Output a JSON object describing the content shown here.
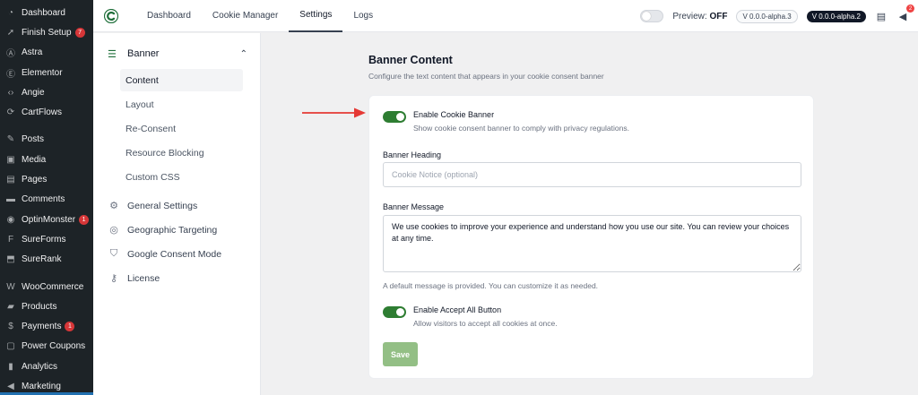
{
  "wp_menu": [
    {
      "label": "Dashboard",
      "icon": "dashboard-icon"
    },
    {
      "label": "Finish Setup",
      "icon": "rocket-icon",
      "badge": "7"
    },
    {
      "label": "Astra",
      "icon": "astra-icon"
    },
    {
      "label": "Elementor",
      "icon": "elementor-icon"
    },
    {
      "label": "Angie",
      "icon": "angie-icon"
    },
    {
      "label": "CartFlows",
      "icon": "cartflows-icon"
    },
    {
      "label": "Posts",
      "icon": "pin-icon"
    },
    {
      "label": "Media",
      "icon": "media-icon"
    },
    {
      "label": "Pages",
      "icon": "pages-icon"
    },
    {
      "label": "Comments",
      "icon": "comment-icon"
    },
    {
      "label": "OptinMonster",
      "icon": "optinmonster-icon",
      "badge": "1"
    },
    {
      "label": "SureForms",
      "icon": "sureforms-icon"
    },
    {
      "label": "SureRank",
      "icon": "surerank-icon"
    },
    {
      "label": "WooCommerce",
      "icon": "woocommerce-icon"
    },
    {
      "label": "Products",
      "icon": "products-icon"
    },
    {
      "label": "Payments",
      "icon": "payments-icon",
      "badge": "1"
    },
    {
      "label": "Power Coupons",
      "icon": "coupon-icon"
    },
    {
      "label": "Analytics",
      "icon": "analytics-icon"
    },
    {
      "label": "Marketing",
      "icon": "megaphone-icon"
    }
  ],
  "topbar": {
    "tabs": [
      "Dashboard",
      "Cookie Manager",
      "Settings",
      "Logs"
    ],
    "active_tab": "Settings",
    "preview_label": "Preview:",
    "preview_state": "OFF",
    "version_light": "V 0.0.0-alpha.3",
    "version_dark": "V 0.0.0-alpha.2",
    "notification_count": "2"
  },
  "settings_nav": {
    "section": "Banner",
    "sub_items": [
      "Content",
      "Layout",
      "Re-Consent",
      "Resource Blocking",
      "Custom CSS"
    ],
    "active_sub": "Content",
    "items": [
      {
        "label": "General Settings",
        "icon": "gear-icon"
      },
      {
        "label": "Geographic Targeting",
        "icon": "globe-icon"
      },
      {
        "label": "Google Consent Mode",
        "icon": "shield-icon"
      },
      {
        "label": "License",
        "icon": "key-icon"
      }
    ]
  },
  "main": {
    "title": "Banner Content",
    "subtitle": "Configure the text content that appears in your cookie consent banner",
    "enable_banner_label": "Enable Cookie Banner",
    "enable_banner_desc": "Show cookie consent banner to comply with privacy regulations.",
    "heading_label": "Banner Heading",
    "heading_placeholder": "Cookie Notice (optional)",
    "message_label": "Banner Message",
    "message_value": "We use cookies to improve your experience and understand how you use our site. You can review your choices at any time.",
    "message_helper": "A default message is provided. You can customize it as needed.",
    "accept_all_label": "Enable Accept All Button",
    "accept_all_desc": "Allow visitors to accept all cookies at once.",
    "save_label": "Save"
  },
  "colors": {
    "toggle_on": "#2e7d32",
    "save_button": "#93bf85",
    "annotation_arrow": "#e53935",
    "wp_sidebar": "#1d2327"
  }
}
